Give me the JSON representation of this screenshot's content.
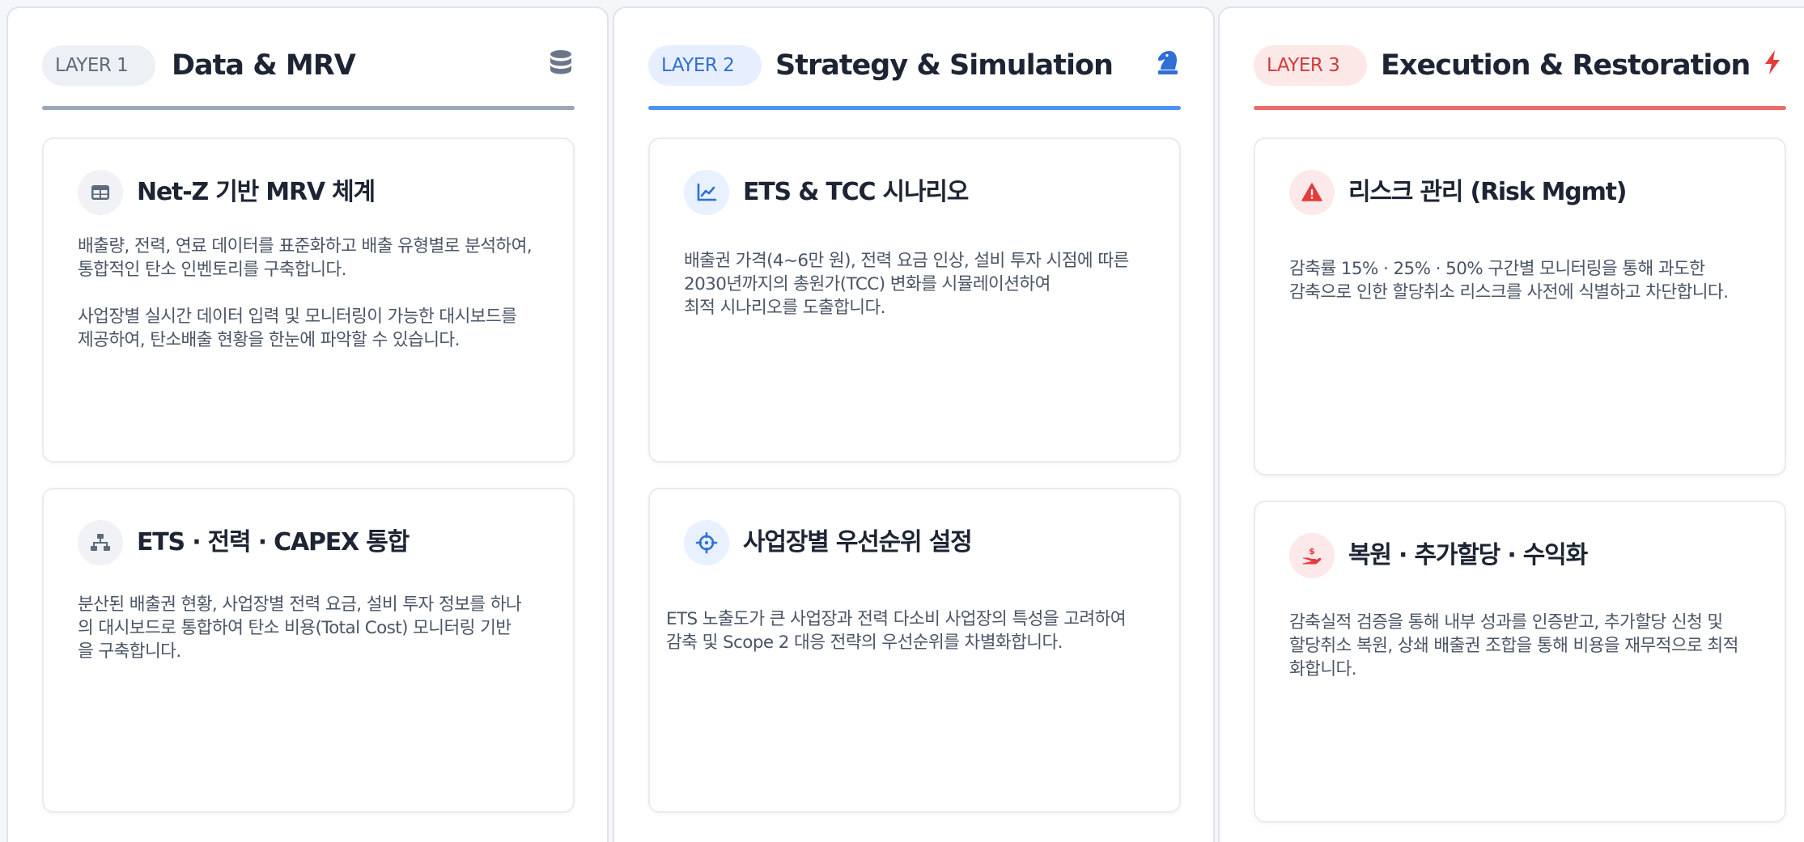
{
  "columns": [
    {
      "layer_label": "LAYER 1",
      "title": "Data & MRV",
      "icon": "database-icon",
      "accent": "#9aa7b8",
      "cards": [
        {
          "icon": "table-icon",
          "title": "Net-Z 기반 MRV 체계",
          "paragraphs": [
            "배출량, 전력, 연료 데이터를 표준화하고 배출 유형별로 분석하여,\n통합적인 탄소 인벤토리를 구축합니다.",
            "사업장별 실시간 데이터 입력 및 모니터링이 가능한 대시보드를\n제공하여, 탄소배출 현황을 한눈에 파악할 수 있습니다."
          ]
        },
        {
          "icon": "sitemap-icon",
          "title": "ETS · 전력 · CAPEX 통합",
          "paragraphs": [
            "분산된 배출권 현황, 사업장별 전력 요금, 설비 투자 정보를 하나\n의 대시보드로 통합하여 탄소 비용(Total Cost) 모니터링 기반\n을 구축합니다."
          ]
        }
      ]
    },
    {
      "layer_label": "LAYER 2",
      "title": "Strategy & Simulation",
      "icon": "chess-knight-icon",
      "accent": "#4b94f0",
      "cards": [
        {
          "icon": "line-chart-icon",
          "title": "ETS & TCC 시나리오",
          "paragraphs": [
            "배출권 가격(4~6만 원), 전력 요금 인상, 설비 투자 시점에 따른\n2030년까지의 총원가(TCC) 변화를 시뮬레이션하여\n최적 시나리오를 도출합니다."
          ]
        },
        {
          "icon": "crosshairs-icon",
          "title": "사업장별 우선순위 설정",
          "paragraphs": [
            "ETS 노출도가 큰 사업장과 전력 다소비 사업장의 특성을 고려하여\n감축 및 Scope 2 대응 전략의 우선순위를 차별화합니다."
          ]
        }
      ]
    },
    {
      "layer_label": "LAYER 3",
      "title": "Execution & Restoration",
      "icon": "bolt-icon",
      "accent": "#ef6a6a",
      "cards": [
        {
          "icon": "warning-icon",
          "title": "리스크 관리 (Risk Mgmt)",
          "paragraphs": [
            "감축률 15% · 25% · 50% 구간별 모니터링을 통해 과도한\n감축으로 인한 할당취소 리스크를 사전에 식별하고 차단합니다."
          ]
        },
        {
          "icon": "hand-dollar-icon",
          "title": "복원 · 추가할당 · 수익화",
          "paragraphs": [
            "감축실적 검증을 통해 내부 성과를 인증받고, 추가할당 신청 및\n할당취소 복원, 상쇄 배출권 조합을 통해 비용을 재무적으로 최적\n화합니다."
          ]
        }
      ]
    }
  ]
}
